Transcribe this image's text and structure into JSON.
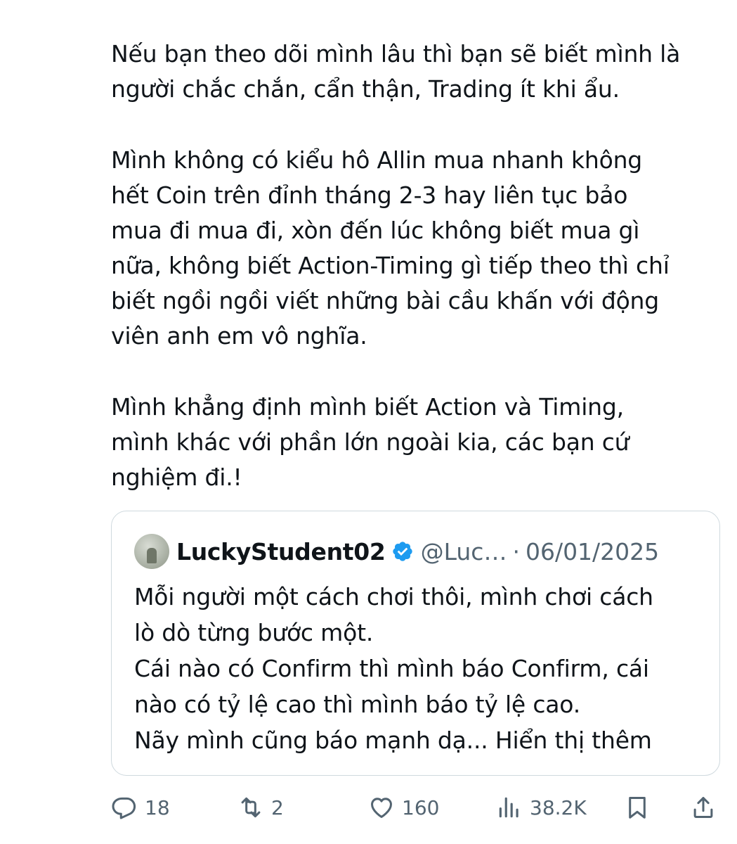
{
  "tweet": {
    "paragraphs": [
      "Nếu bạn theo dõi mình lâu thì bạn sẽ biết mình là\nngười chắc chắn, cẩn thận, Trading ít khi ẩu.",
      "Mình không có kiểu hô Allin mua nhanh không\nhết Coin trên đỉnh tháng 2-3 hay liên tục bảo\nmua đi mua đi, xòn đến lúc không biết mua gì\nnữa, không biết Action-Timing gì tiếp theo thì chỉ\nbiết ngồi ngồi viết những bài cầu khấn với động\nviên anh em vô nghĩa.",
      "Mình khẳng định mình biết Action và Timing,\nmình khác với phần lớn ngoài kia, các bạn cứ\nnghiệm đi.!"
    ]
  },
  "quote": {
    "name": "LuckyStudent02",
    "handle": "@Luc…",
    "dot": "·",
    "date": "06/01/2025",
    "text": "Mỗi người một cách chơi thôi, mình chơi cách\nlò dò từng bước một.\nCái nào có Confirm thì mình báo Confirm, cái\nnào có tỷ lệ cao thì mình báo tỷ lệ cao.\nNãy mình cũng báo mạnh dạ... ",
    "show_more": "Hiển thị thêm",
    "verified_color": "#1d9bf0"
  },
  "actions": {
    "replies": "18",
    "reposts": "2",
    "likes": "160",
    "views": "38.2K",
    "icons": [
      "reply-icon",
      "repost-icon",
      "like-icon",
      "views-icon",
      "bookmark-icon",
      "share-icon"
    ]
  }
}
